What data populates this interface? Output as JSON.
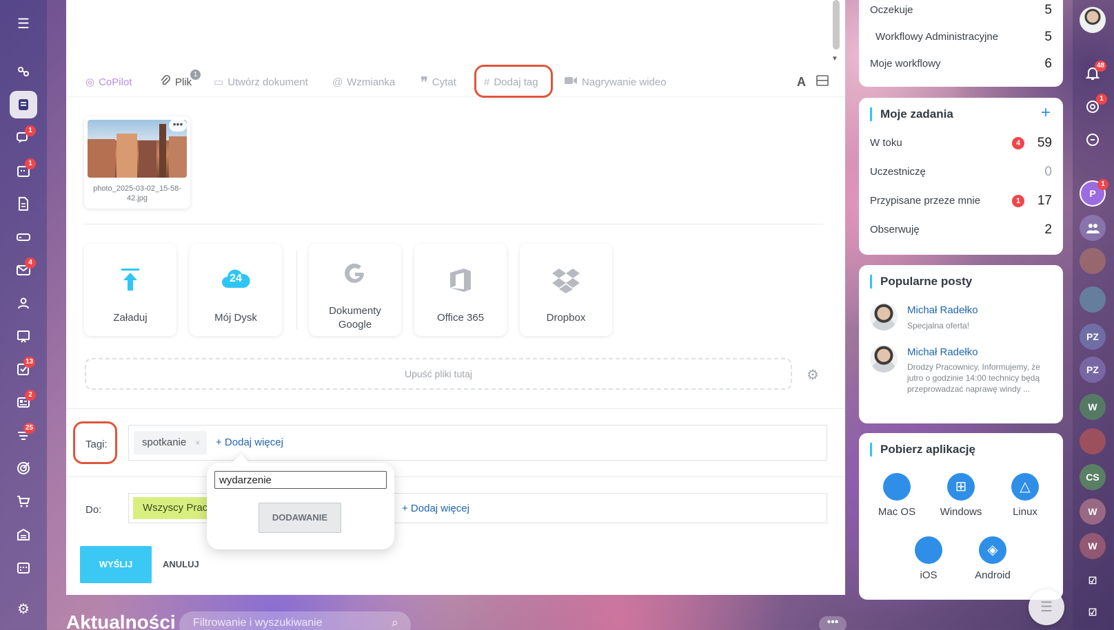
{
  "toolbar": {
    "copilot": "CoPilot",
    "file": "Plik",
    "file_count": "1",
    "create_doc": "Utwórz dokument",
    "mention": "Wzmianka",
    "quote": "Cytat",
    "add_tag": "Dodaj tag",
    "video": "Nagrywanie wideo",
    "font_glyph": "A"
  },
  "attachment": {
    "filename": "photo_2025-03-02_15-58-42.jpg",
    "menu": "•••"
  },
  "sources": {
    "upload": "Załaduj",
    "my_drive": "Mój Dysk",
    "my_drive_badge": "24",
    "google_docs_line1": "Dokumenty",
    "google_docs_line2": "Google",
    "office": "Office 365",
    "dropbox": "Dropbox"
  },
  "dropzone": "Upuść pliki tutaj",
  "tags": {
    "label": "Tagi:",
    "chip": "spotkanie",
    "chip_remove": "×",
    "add_more": "+ Dodaj więcej"
  },
  "popup": {
    "input_value": "wydarzenie",
    "button": "DODAWANIE"
  },
  "recipients": {
    "label": "Do:",
    "chip": "Wszyscy Pracownicy",
    "add_more": "+ Dodaj więcej"
  },
  "actions": {
    "send": "WYŚLIJ",
    "cancel": "ANULUJ"
  },
  "feed": {
    "title": "Aktualności",
    "filter_placeholder": "Filtrowanie i wyszukiwanie",
    "more": "•••"
  },
  "workflows": {
    "rows": [
      {
        "label": "Oczekuje",
        "count": "5"
      },
      {
        "label": "Workflowy Administracyjne",
        "count": "5"
      },
      {
        "label": "Moje workflowy",
        "count": "6"
      }
    ]
  },
  "tasks": {
    "title": "Moje zadania",
    "add": "+",
    "rows": [
      {
        "label": "W toku",
        "badge": "4",
        "count": "59"
      },
      {
        "label": "Uczestniczę",
        "count": "0"
      },
      {
        "label": "Przypisane przeze mnie",
        "badge": "1",
        "count": "17"
      },
      {
        "label": "Obserwuję",
        "count": "2"
      }
    ]
  },
  "popular": {
    "title": "Popularne posty",
    "posts": [
      {
        "author": "Michał Radełko",
        "text": "Specjalna oferta!"
      },
      {
        "author": "Michał Radełko",
        "text": "Drodzy Pracownicy, Informujemy, że jutro o godzinie 14:00 technicy będą przeprowadzać naprawę windy ..."
      }
    ]
  },
  "apps": {
    "title": "Pobierz aplikację",
    "items": [
      "Mac OS",
      "Windows",
      "Linux",
      "iOS",
      "Android"
    ]
  },
  "left_badges": {
    "chat": "1",
    "calendar": "1",
    "mail": "4",
    "tasks": "13",
    "news": "2",
    "funnel": "25"
  },
  "right_badges": {
    "notifications": "48",
    "activity": "1",
    "user_p": "1"
  },
  "right_avatars": [
    "P",
    "PZ",
    "PZ",
    "W",
    "CS",
    "W",
    "W"
  ],
  "colors": {
    "accent": "#2fc6f6",
    "send": "#3bc8f5",
    "link": "#2066b0",
    "highlight": "#e0553a",
    "badge": "#f0454a",
    "recipient_chip": "#d8ef80"
  }
}
